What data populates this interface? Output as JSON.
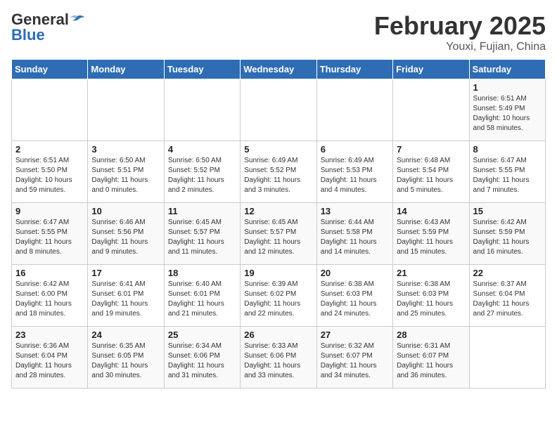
{
  "header": {
    "logo_general": "General",
    "logo_blue": "Blue",
    "title": "February 2025",
    "subtitle": "Youxi, Fujian, China"
  },
  "weekdays": [
    "Sunday",
    "Monday",
    "Tuesday",
    "Wednesday",
    "Thursday",
    "Friday",
    "Saturday"
  ],
  "weeks": [
    [
      {
        "day": "",
        "detail": ""
      },
      {
        "day": "",
        "detail": ""
      },
      {
        "day": "",
        "detail": ""
      },
      {
        "day": "",
        "detail": ""
      },
      {
        "day": "",
        "detail": ""
      },
      {
        "day": "",
        "detail": ""
      },
      {
        "day": "1",
        "detail": "Sunrise: 6:51 AM\nSunset: 5:49 PM\nDaylight: 10 hours\nand 58 minutes."
      }
    ],
    [
      {
        "day": "2",
        "detail": "Sunrise: 6:51 AM\nSunset: 5:50 PM\nDaylight: 10 hours\nand 59 minutes."
      },
      {
        "day": "3",
        "detail": "Sunrise: 6:50 AM\nSunset: 5:51 PM\nDaylight: 11 hours\nand 0 minutes."
      },
      {
        "day": "4",
        "detail": "Sunrise: 6:50 AM\nSunset: 5:52 PM\nDaylight: 11 hours\nand 2 minutes."
      },
      {
        "day": "5",
        "detail": "Sunrise: 6:49 AM\nSunset: 5:52 PM\nDaylight: 11 hours\nand 3 minutes."
      },
      {
        "day": "6",
        "detail": "Sunrise: 6:49 AM\nSunset: 5:53 PM\nDaylight: 11 hours\nand 4 minutes."
      },
      {
        "day": "7",
        "detail": "Sunrise: 6:48 AM\nSunset: 5:54 PM\nDaylight: 11 hours\nand 5 minutes."
      },
      {
        "day": "8",
        "detail": "Sunrise: 6:47 AM\nSunset: 5:55 PM\nDaylight: 11 hours\nand 7 minutes."
      }
    ],
    [
      {
        "day": "9",
        "detail": "Sunrise: 6:47 AM\nSunset: 5:55 PM\nDaylight: 11 hours\nand 8 minutes."
      },
      {
        "day": "10",
        "detail": "Sunrise: 6:46 AM\nSunset: 5:56 PM\nDaylight: 11 hours\nand 9 minutes."
      },
      {
        "day": "11",
        "detail": "Sunrise: 6:45 AM\nSunset: 5:57 PM\nDaylight: 11 hours\nand 11 minutes."
      },
      {
        "day": "12",
        "detail": "Sunrise: 6:45 AM\nSunset: 5:57 PM\nDaylight: 11 hours\nand 12 minutes."
      },
      {
        "day": "13",
        "detail": "Sunrise: 6:44 AM\nSunset: 5:58 PM\nDaylight: 11 hours\nand 14 minutes."
      },
      {
        "day": "14",
        "detail": "Sunrise: 6:43 AM\nSunset: 5:59 PM\nDaylight: 11 hours\nand 15 minutes."
      },
      {
        "day": "15",
        "detail": "Sunrise: 6:42 AM\nSunset: 5:59 PM\nDaylight: 11 hours\nand 16 minutes."
      }
    ],
    [
      {
        "day": "16",
        "detail": "Sunrise: 6:42 AM\nSunset: 6:00 PM\nDaylight: 11 hours\nand 18 minutes."
      },
      {
        "day": "17",
        "detail": "Sunrise: 6:41 AM\nSunset: 6:01 PM\nDaylight: 11 hours\nand 19 minutes."
      },
      {
        "day": "18",
        "detail": "Sunrise: 6:40 AM\nSunset: 6:01 PM\nDaylight: 11 hours\nand 21 minutes."
      },
      {
        "day": "19",
        "detail": "Sunrise: 6:39 AM\nSunset: 6:02 PM\nDaylight: 11 hours\nand 22 minutes."
      },
      {
        "day": "20",
        "detail": "Sunrise: 6:38 AM\nSunset: 6:03 PM\nDaylight: 11 hours\nand 24 minutes."
      },
      {
        "day": "21",
        "detail": "Sunrise: 6:38 AM\nSunset: 6:03 PM\nDaylight: 11 hours\nand 25 minutes."
      },
      {
        "day": "22",
        "detail": "Sunrise: 6:37 AM\nSunset: 6:04 PM\nDaylight: 11 hours\nand 27 minutes."
      }
    ],
    [
      {
        "day": "23",
        "detail": "Sunrise: 6:36 AM\nSunset: 6:04 PM\nDaylight: 11 hours\nand 28 minutes."
      },
      {
        "day": "24",
        "detail": "Sunrise: 6:35 AM\nSunset: 6:05 PM\nDaylight: 11 hours\nand 30 minutes."
      },
      {
        "day": "25",
        "detail": "Sunrise: 6:34 AM\nSunset: 6:06 PM\nDaylight: 11 hours\nand 31 minutes."
      },
      {
        "day": "26",
        "detail": "Sunrise: 6:33 AM\nSunset: 6:06 PM\nDaylight: 11 hours\nand 33 minutes."
      },
      {
        "day": "27",
        "detail": "Sunrise: 6:32 AM\nSunset: 6:07 PM\nDaylight: 11 hours\nand 34 minutes."
      },
      {
        "day": "28",
        "detail": "Sunrise: 6:31 AM\nSunset: 6:07 PM\nDaylight: 11 hours\nand 36 minutes."
      },
      {
        "day": "",
        "detail": ""
      }
    ]
  ]
}
